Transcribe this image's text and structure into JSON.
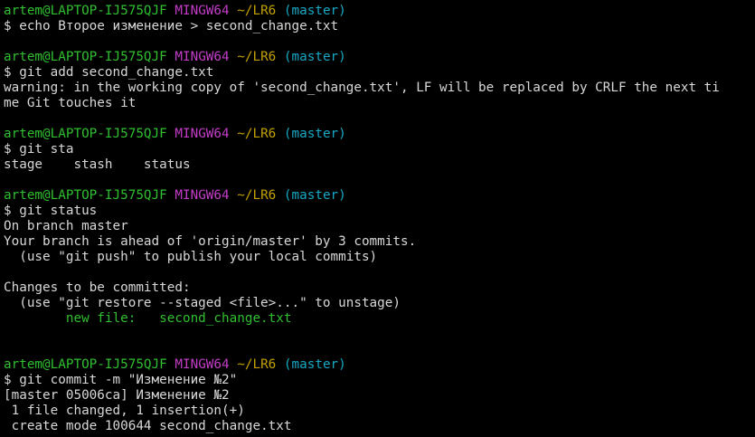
{
  "colors": {
    "background": "#000000",
    "text": "#d8d8d8",
    "user_host": "#2fbf2f",
    "system": "#c33cc8",
    "path": "#c2a000",
    "branch": "#17a8c4",
    "staged": "#2fbf2f"
  },
  "prompt": {
    "user_host": "artem@LAPTOP-IJ575QJF",
    "system": "MINGW64",
    "path": "~/LR6",
    "branch": "(master)"
  },
  "session": [
    {
      "kind": "prompt"
    },
    {
      "kind": "command",
      "text": "$ echo Второе изменение > second_change.txt"
    },
    {
      "kind": "blank"
    },
    {
      "kind": "prompt"
    },
    {
      "kind": "command",
      "text": "$ git add second_change.txt"
    },
    {
      "kind": "output",
      "text": "warning: in the working copy of 'second_change.txt', LF will be replaced by CRLF the next ti"
    },
    {
      "kind": "output",
      "text": "me Git touches it"
    },
    {
      "kind": "blank"
    },
    {
      "kind": "prompt"
    },
    {
      "kind": "command",
      "text": "$ git sta"
    },
    {
      "kind": "output",
      "text": "stage    stash    status"
    },
    {
      "kind": "blank"
    },
    {
      "kind": "prompt"
    },
    {
      "kind": "command",
      "text": "$ git status"
    },
    {
      "kind": "output",
      "text": "On branch master"
    },
    {
      "kind": "output",
      "text": "Your branch is ahead of 'origin/master' by 3 commits."
    },
    {
      "kind": "output",
      "text": "  (use \"git push\" to publish your local commits)"
    },
    {
      "kind": "blank"
    },
    {
      "kind": "output",
      "text": "Changes to be committed:"
    },
    {
      "kind": "output",
      "text": "  (use \"git restore --staged <file>...\" to unstage)"
    },
    {
      "kind": "staged",
      "text": "        new file:   second_change.txt"
    },
    {
      "kind": "blank"
    },
    {
      "kind": "blank"
    },
    {
      "kind": "prompt"
    },
    {
      "kind": "command",
      "text": "$ git commit -m \"Изменение №2\""
    },
    {
      "kind": "output",
      "text": "[master 05006ca] Изменение №2"
    },
    {
      "kind": "output",
      "text": " 1 file changed, 1 insertion(+)"
    },
    {
      "kind": "output",
      "text": " create mode 100644 second_change.txt"
    }
  ]
}
